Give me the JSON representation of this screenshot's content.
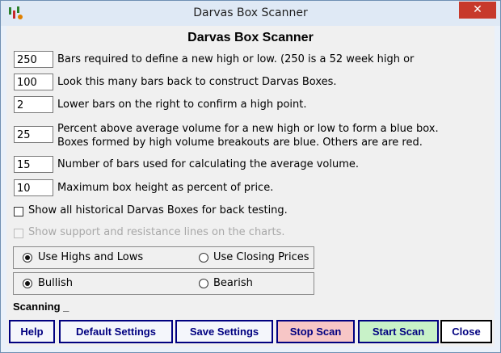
{
  "window": {
    "title": "Darvas Box Scanner",
    "close_glyph": "✕"
  },
  "heading": "Darvas Box Scanner",
  "settings": [
    {
      "value": "250",
      "label": "Bars required to define a new high or low.  (250 is a 52 week high or"
    },
    {
      "value": "100",
      "label": "Look this many bars back to construct Darvas Boxes."
    },
    {
      "value": "2",
      "label": "Lower bars on the right to confirm a high point."
    },
    {
      "value": "25",
      "label_line1": "Percent above average volume for a new high or low to form a blue box.",
      "label_line2": "Boxes formed by high volume breakouts are blue.  Others are are red."
    },
    {
      "value": "15",
      "label": "Number of bars used for calculating the average volume."
    },
    {
      "value": "10",
      "label": "Maximum box height as percent of  price."
    }
  ],
  "checkboxes": {
    "historical": {
      "label": "Show all historical Darvas Boxes for back testing.",
      "checked": false
    },
    "support_resistance": {
      "label": "Show support and resistance lines on the charts.",
      "checked": false,
      "disabled": true
    }
  },
  "price_mode": {
    "option1": "Use Highs and Lows",
    "option2": "Use Closing Prices",
    "selected": "option1"
  },
  "direction": {
    "option1": "Bullish",
    "option2": "Bearish",
    "selected": "option1"
  },
  "status": "Scanning _",
  "buttons": {
    "help": "Help",
    "default_settings": "Default Settings",
    "save_settings": "Save Settings",
    "stop_scan": "Stop Scan",
    "start_scan": "Start Scan",
    "close": "Close"
  },
  "colors": {
    "button_border": "#000080",
    "stop_scan_bg": "#f7c6c6",
    "start_scan_bg": "#c8f2c8",
    "close_button_red": "#c7392b"
  }
}
